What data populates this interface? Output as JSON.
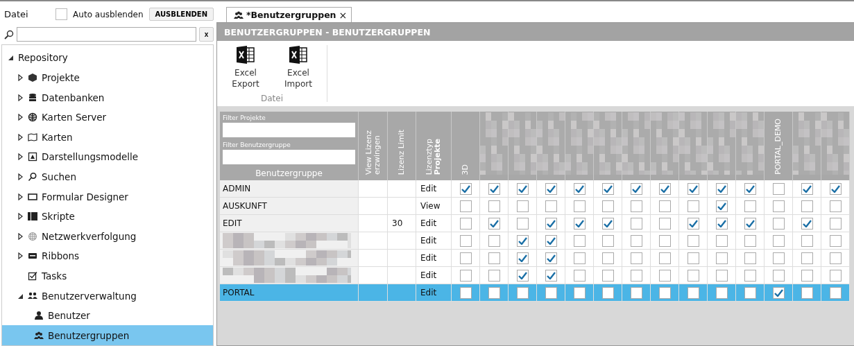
{
  "sidebar": {
    "title": "Datei",
    "auto_hide": {
      "label": "Auto ausblenden",
      "checked": false
    },
    "hide_button": "AUSBLENDEN",
    "search": {
      "clear": "x"
    },
    "tree": [
      {
        "label": "Repository",
        "expanded": true,
        "children": [
          {
            "label": "Projekte",
            "expanded": false,
            "selected": false
          },
          {
            "label": "Datenbanken",
            "expanded": false,
            "selected": false
          },
          {
            "label": "Karten Server",
            "expanded": false,
            "selected": false
          },
          {
            "label": "Karten",
            "expanded": false,
            "selected": false
          },
          {
            "label": "Darstellungsmodelle",
            "expanded": false,
            "selected": false
          },
          {
            "label": "Suchen",
            "expanded": false,
            "selected": false
          },
          {
            "label": "Formular Designer",
            "expanded": false,
            "selected": false
          },
          {
            "label": "Skripte",
            "expanded": false,
            "selected": false
          },
          {
            "label": "Netzwerkverfolgung",
            "expanded": false,
            "selected": false
          },
          {
            "label": "Ribbons",
            "expanded": false,
            "selected": false
          },
          {
            "label": "Tasks",
            "selected": false
          },
          {
            "label": "Benutzerverwaltung",
            "expanded": true,
            "selected": false,
            "children": [
              {
                "label": "Benutzer",
                "selected": false
              },
              {
                "label": "Benutzergruppen",
                "selected": true
              }
            ]
          }
        ]
      }
    ]
  },
  "tab": {
    "label": "*Benutzergruppen",
    "close": "×"
  },
  "panel": {
    "title": "BENUTZERGRUPPEN - BENUTZERGRUPPEN",
    "ribbon": {
      "group": "Datei",
      "buttons": [
        {
          "line1": "Excel",
          "line2": "Export"
        },
        {
          "line1": "Excel",
          "line2": "Import"
        }
      ]
    },
    "grid": {
      "filters": [
        {
          "label": "Filter Projekte"
        },
        {
          "label": "Filter Benutzergruppe"
        }
      ],
      "name_header": "Benutzergruppe",
      "headers": [
        {
          "label": "View Lizenz erzwingen"
        },
        {
          "label": "Lizenz Limit"
        },
        {
          "label": "Lizenztyp",
          "label2": "Projekte"
        }
      ],
      "project_columns": [
        {
          "kind": "text",
          "label": "3D"
        },
        {
          "kind": "blurred"
        },
        {
          "kind": "blurred"
        },
        {
          "kind": "blurred"
        },
        {
          "kind": "blurred"
        },
        {
          "kind": "blurred"
        },
        {
          "kind": "blurred"
        },
        {
          "kind": "blurred"
        },
        {
          "kind": "blurred"
        },
        {
          "kind": "blurred"
        },
        {
          "kind": "blurred"
        },
        {
          "kind": "text",
          "label": "PORTAL_DEMO"
        },
        {
          "kind": "blurred"
        },
        {
          "kind": "blurred"
        }
      ],
      "rows": [
        {
          "kind": "text",
          "name": "ADMIN",
          "license": "Edit",
          "selected": false,
          "checks": [
            true,
            true,
            true,
            true,
            true,
            true,
            true,
            true,
            true,
            true,
            true,
            false,
            true,
            true
          ]
        },
        {
          "kind": "text",
          "name": "AUSKUNFT",
          "license": "View",
          "selected": false,
          "checks": [
            false,
            false,
            false,
            false,
            false,
            false,
            false,
            false,
            false,
            true,
            false,
            false,
            false,
            false
          ]
        },
        {
          "kind": "text",
          "name": "EDIT",
          "limit": "30",
          "license": "Edit",
          "selected": false,
          "checks": [
            false,
            true,
            false,
            true,
            true,
            true,
            false,
            false,
            true,
            true,
            true,
            false,
            true,
            false
          ]
        },
        {
          "kind": "blurred",
          "license": "Edit",
          "selected": false,
          "checks": [
            false,
            false,
            true,
            true,
            false,
            false,
            false,
            false,
            false,
            false,
            false,
            false,
            false,
            false
          ]
        },
        {
          "kind": "blurred",
          "license": "Edit",
          "selected": false,
          "checks": [
            false,
            false,
            true,
            true,
            false,
            false,
            false,
            false,
            false,
            false,
            false,
            false,
            false,
            false
          ]
        },
        {
          "kind": "blurred",
          "license": "Edit",
          "selected": false,
          "checks": [
            false,
            false,
            true,
            true,
            false,
            false,
            false,
            false,
            false,
            false,
            false,
            false,
            false,
            false
          ]
        },
        {
          "kind": "text",
          "name": "PORTAL",
          "license": "Edit",
          "selected": true,
          "checks": [
            false,
            false,
            false,
            false,
            false,
            false,
            false,
            false,
            false,
            false,
            false,
            true,
            false,
            false
          ]
        }
      ]
    }
  }
}
